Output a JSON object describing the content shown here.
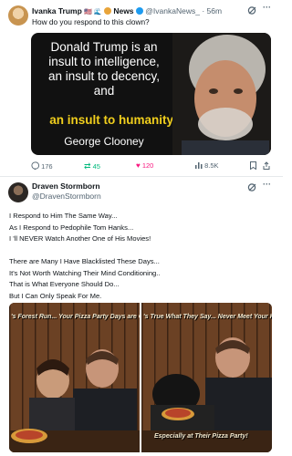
{
  "post1": {
    "display_name": "Ivanka Trump",
    "name_emojis": "🇺🇸 🌊",
    "news_badge": "News",
    "handle": "@IvankaNews_",
    "time": "· 56m",
    "text": "How do you respond to this clown?",
    "media": {
      "quote_line1": "Donald Trump is an",
      "quote_line2": "insult to intelligence,",
      "quote_line3": "an insult to decency,",
      "quote_line4": "and",
      "quote_highlight": "an insult to humanity.",
      "attribution": "George Clooney"
    },
    "stats": {
      "replies": "176",
      "reposts": "45",
      "likes": "120",
      "views": "8.5K"
    }
  },
  "post2": {
    "display_name": "Draven Stormborn",
    "handle": "@DravenStormborn",
    "lines": [
      "I Respond to Him The Same Way...",
      "As I Respond to Pedophile Tom Hanks...",
      "I 'll NEVER Watch Another One of His Movies!",
      "",
      "There are Many I Have Blacklisted These Days...",
      "It's Not Worth Watching Their Mind Conditioning..",
      "That is What Everyone Should Do...",
      "But I Can Only Speak For Me."
    ],
    "media": {
      "left_caption": "'s Forest Run... Your Pizza Party Days are Ov",
      "right_caption": "'s True What They Say... Never Meet Your Heros",
      "right_caption2": "Especially at Their Pizza Party!"
    }
  },
  "colors": {
    "repost": "#00ba7c",
    "like": "#f91880",
    "verified": "#1d9bf0",
    "highlight": "#f1cf1d"
  }
}
